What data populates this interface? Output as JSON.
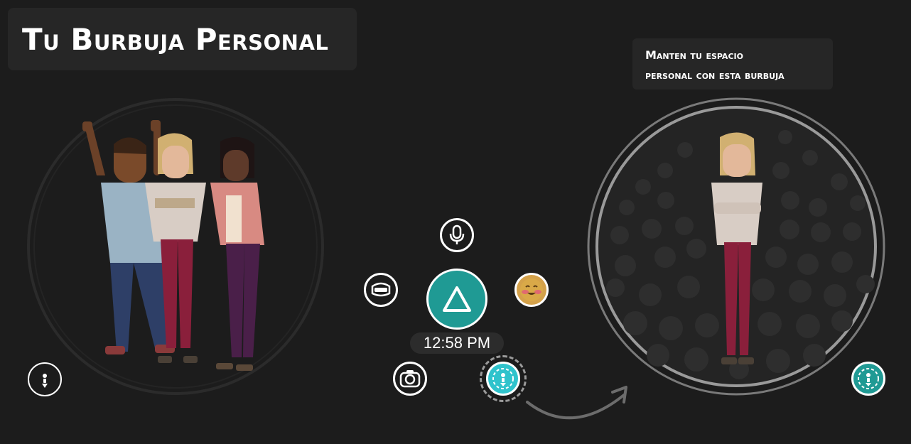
{
  "title": "Tu Burbuja Personal",
  "note": {
    "line1": "Manten tu espacio",
    "line2": "personal con esta burbuja"
  },
  "menu": {
    "time": "12:58 PM",
    "icons": [
      "microphone-icon",
      "headset-icon",
      "home-icon",
      "emoji-icon",
      "camera-icon",
      "personal-bubble-icon"
    ]
  },
  "colors": {
    "background": "#1c1c1c",
    "panel": "#262626",
    "teal": "#1f9a94",
    "bubble_active": "#2fc3cc"
  }
}
